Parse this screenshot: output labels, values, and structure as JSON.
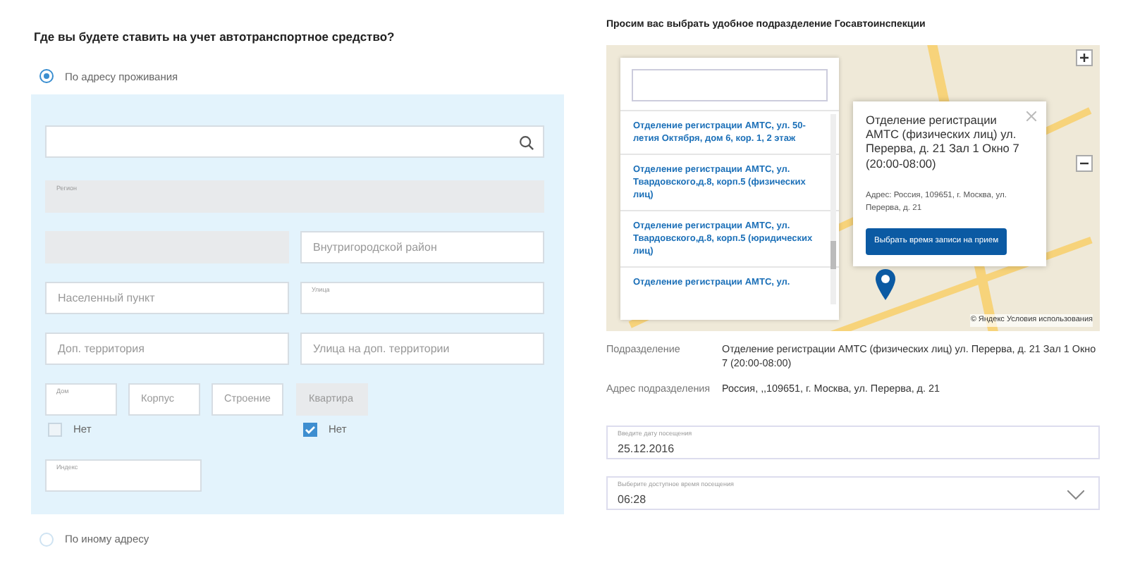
{
  "left": {
    "title": "Где вы будете ставить на учет автотранспортное средство?",
    "options": [
      {
        "label": "По адресу проживания",
        "selected": true
      },
      {
        "label": "По иному адресу",
        "selected": false
      }
    ],
    "search_field": {
      "kind": "search"
    },
    "rows": [
      [
        {
          "kind": "labeled",
          "label": "Регион",
          "disabled": true
        }
      ],
      [
        {
          "kind": "plain",
          "disabled": true
        },
        {
          "kind": "placeholder",
          "placeholder": "Внутригородской район",
          "disabled": false
        }
      ],
      [
        {
          "kind": "placeholder",
          "placeholder": "Населенный пункт",
          "disabled": false
        },
        {
          "kind": "labeled",
          "label": "Улица",
          "disabled": false
        }
      ],
      [
        {
          "kind": "placeholder",
          "placeholder": "Доп. территория",
          "disabled": false
        },
        {
          "kind": "placeholder",
          "placeholder": "Улица на доп. территории",
          "disabled": false
        }
      ],
      [
        {
          "kind": "labeled",
          "label": "Дом",
          "disabled": false
        },
        {
          "kind": "placeholder",
          "placeholder": "Корпус",
          "disabled": false
        },
        {
          "kind": "placeholder",
          "placeholder": "Строение",
          "disabled": false
        },
        {
          "kind": "placeholder",
          "placeholder": "Квартира",
          "disabled": true
        }
      ]
    ],
    "checkboxes": [
      {
        "label": "Нет",
        "checked": false
      },
      {
        "label": "Нет",
        "checked": true
      }
    ],
    "index_field": {
      "label": "Индекс"
    }
  },
  "right": {
    "title": "Просим вас выбрать удобное подразделение Госавтоинспекции",
    "map": {
      "list_items": [
        "Отделение регистрации АМТС, ул. 50-летия Октября, дом 6, кор. 1, 2 этаж",
        "Отделение регистрации АМТС, ул. Твардовского,д.8, корп.5 (физических лиц)",
        "Отделение регистрации АМТС, ул. Твардовского,д.8, корп.5 (юридических лиц)",
        "Отделение регистрации АМТС, ул."
      ],
      "popup": {
        "title": "Отделение регистрации АМТС (физических лиц) ул. Перерва, д. 21 Зал 1 Окно 7 (20:00-08:00)",
        "address": "Адрес: Россия, 109651, г. Москва, ул. Перерва, д. 21",
        "button": "Выбрать время записи на прием"
      },
      "copyright": "© Яндекс",
      "terms_link": "Условия использования"
    },
    "details": [
      {
        "label": "Подразделение",
        "value": "Отделение регистрации АМТС (физических лиц) ул. Перерва, д. 21 Зал 1 Окно 7 (20:00-08:00)"
      },
      {
        "label": "Адрес подразделения",
        "value": "Россия, ,,109651, г. Москва, ул. Перерва, д. 21"
      }
    ],
    "date_field": {
      "label": "Введите дату посещения",
      "value": "25.12.2016"
    },
    "time_select": {
      "label": "Выберите доступное время посещения",
      "value": "06:28"
    }
  }
}
